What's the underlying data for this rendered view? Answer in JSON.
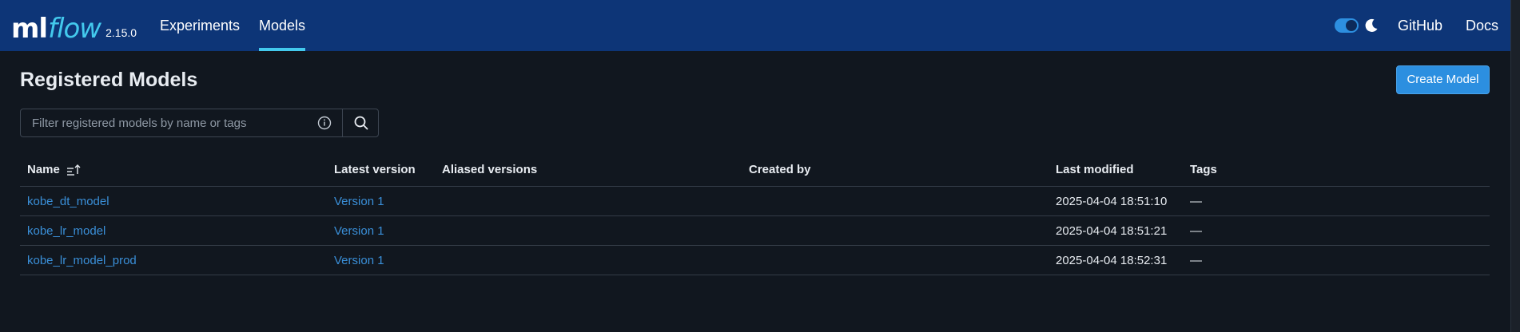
{
  "header": {
    "logo_ml": "ml",
    "logo_flow": "flow",
    "version": "2.15.0",
    "nav": {
      "experiments": "Experiments",
      "models": "Models",
      "github": "GitHub",
      "docs": "Docs"
    },
    "dark_mode_toggle": "on",
    "colors": {
      "bar": "#0d3577",
      "accent": "#43c9ed"
    }
  },
  "page": {
    "title": "Registered Models",
    "create_button": "Create Model",
    "search": {
      "placeholder": "Filter registered models by name or tags",
      "value": ""
    }
  },
  "table": {
    "columns": {
      "name": "Name",
      "latest_version": "Latest version",
      "aliased_versions": "Aliased versions",
      "created_by": "Created by",
      "last_modified": "Last modified",
      "tags": "Tags"
    },
    "sort": {
      "column": "Name",
      "direction": "ascending"
    },
    "rows": [
      {
        "name": "kobe_dt_model",
        "latest_version": "Version 1",
        "aliased_versions": "",
        "created_by": "",
        "last_modified": "2025-04-04 18:51:10",
        "tags": "—"
      },
      {
        "name": "kobe_lr_model",
        "latest_version": "Version 1",
        "aliased_versions": "",
        "created_by": "",
        "last_modified": "2025-04-04 18:51:21",
        "tags": "—"
      },
      {
        "name": "kobe_lr_model_prod",
        "latest_version": "Version 1",
        "aliased_versions": "",
        "created_by": "",
        "last_modified": "2025-04-04 18:52:31",
        "tags": "—"
      }
    ]
  }
}
